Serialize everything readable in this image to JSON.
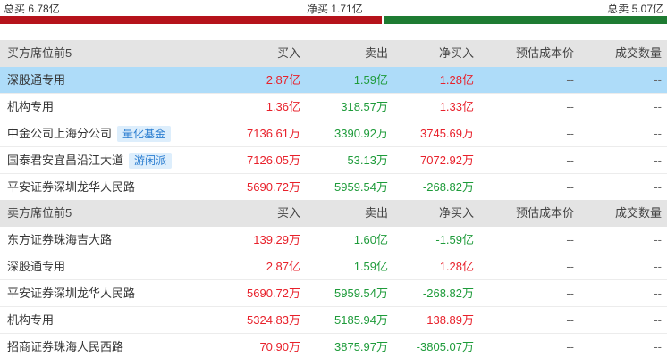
{
  "summary": {
    "total_buy": "总买 6.78亿",
    "net_buy": "净买 1.71亿",
    "total_sell": "总卖 5.07亿",
    "buy_ratio": 0.572,
    "colors": {
      "buy_bar": "#b5121b",
      "sell_bar": "#1e7b32"
    }
  },
  "buy_table": {
    "header": {
      "name": "买方席位前5",
      "buy": "买入",
      "sell": "卖出",
      "net": "净买入",
      "cost": "预估成本价",
      "volume": "成交数量"
    },
    "rows": [
      {
        "name": "深股通专用",
        "tag": "",
        "buy": "2.87亿",
        "sell": "1.59亿",
        "net": "1.28亿",
        "cost": "--",
        "volume": "--",
        "highlighted": true
      },
      {
        "name": "机构专用",
        "tag": "",
        "buy": "1.36亿",
        "sell": "318.57万",
        "net": "1.33亿",
        "cost": "--",
        "volume": "--"
      },
      {
        "name": "中金公司上海分公司",
        "tag": "量化基金",
        "buy": "7136.61万",
        "sell": "3390.92万",
        "net": "3745.69万",
        "cost": "--",
        "volume": "--"
      },
      {
        "name": "国泰君安宜昌沿江大道",
        "tag": "游闲派",
        "buy": "7126.05万",
        "sell": "53.13万",
        "net": "7072.92万",
        "cost": "--",
        "volume": "--"
      },
      {
        "name": "平安证券深圳龙华人民路",
        "tag": "",
        "buy": "5690.72万",
        "sell": "5959.54万",
        "net": "-268.82万",
        "cost": "--",
        "volume": "--"
      }
    ]
  },
  "sell_table": {
    "header": {
      "name": "卖方席位前5",
      "buy": "买入",
      "sell": "卖出",
      "net": "净买入",
      "cost": "预估成本价",
      "volume": "成交数量"
    },
    "rows": [
      {
        "name": "东方证券珠海吉大路",
        "buy": "139.29万",
        "sell": "1.60亿",
        "net": "-1.59亿",
        "cost": "--",
        "volume": "--"
      },
      {
        "name": "深股通专用",
        "buy": "2.87亿",
        "sell": "1.59亿",
        "net": "1.28亿",
        "cost": "--",
        "volume": "--"
      },
      {
        "name": "平安证券深圳龙华人民路",
        "buy": "5690.72万",
        "sell": "5959.54万",
        "net": "-268.82万",
        "cost": "--",
        "volume": "--"
      },
      {
        "name": "机构专用",
        "buy": "5324.83万",
        "sell": "5185.94万",
        "net": "138.89万",
        "cost": "--",
        "volume": "--"
      },
      {
        "name": "招商证券珠海人民西路",
        "buy": "70.90万",
        "sell": "3875.97万",
        "net": "-3805.07万",
        "cost": "--",
        "volume": "--"
      }
    ]
  }
}
